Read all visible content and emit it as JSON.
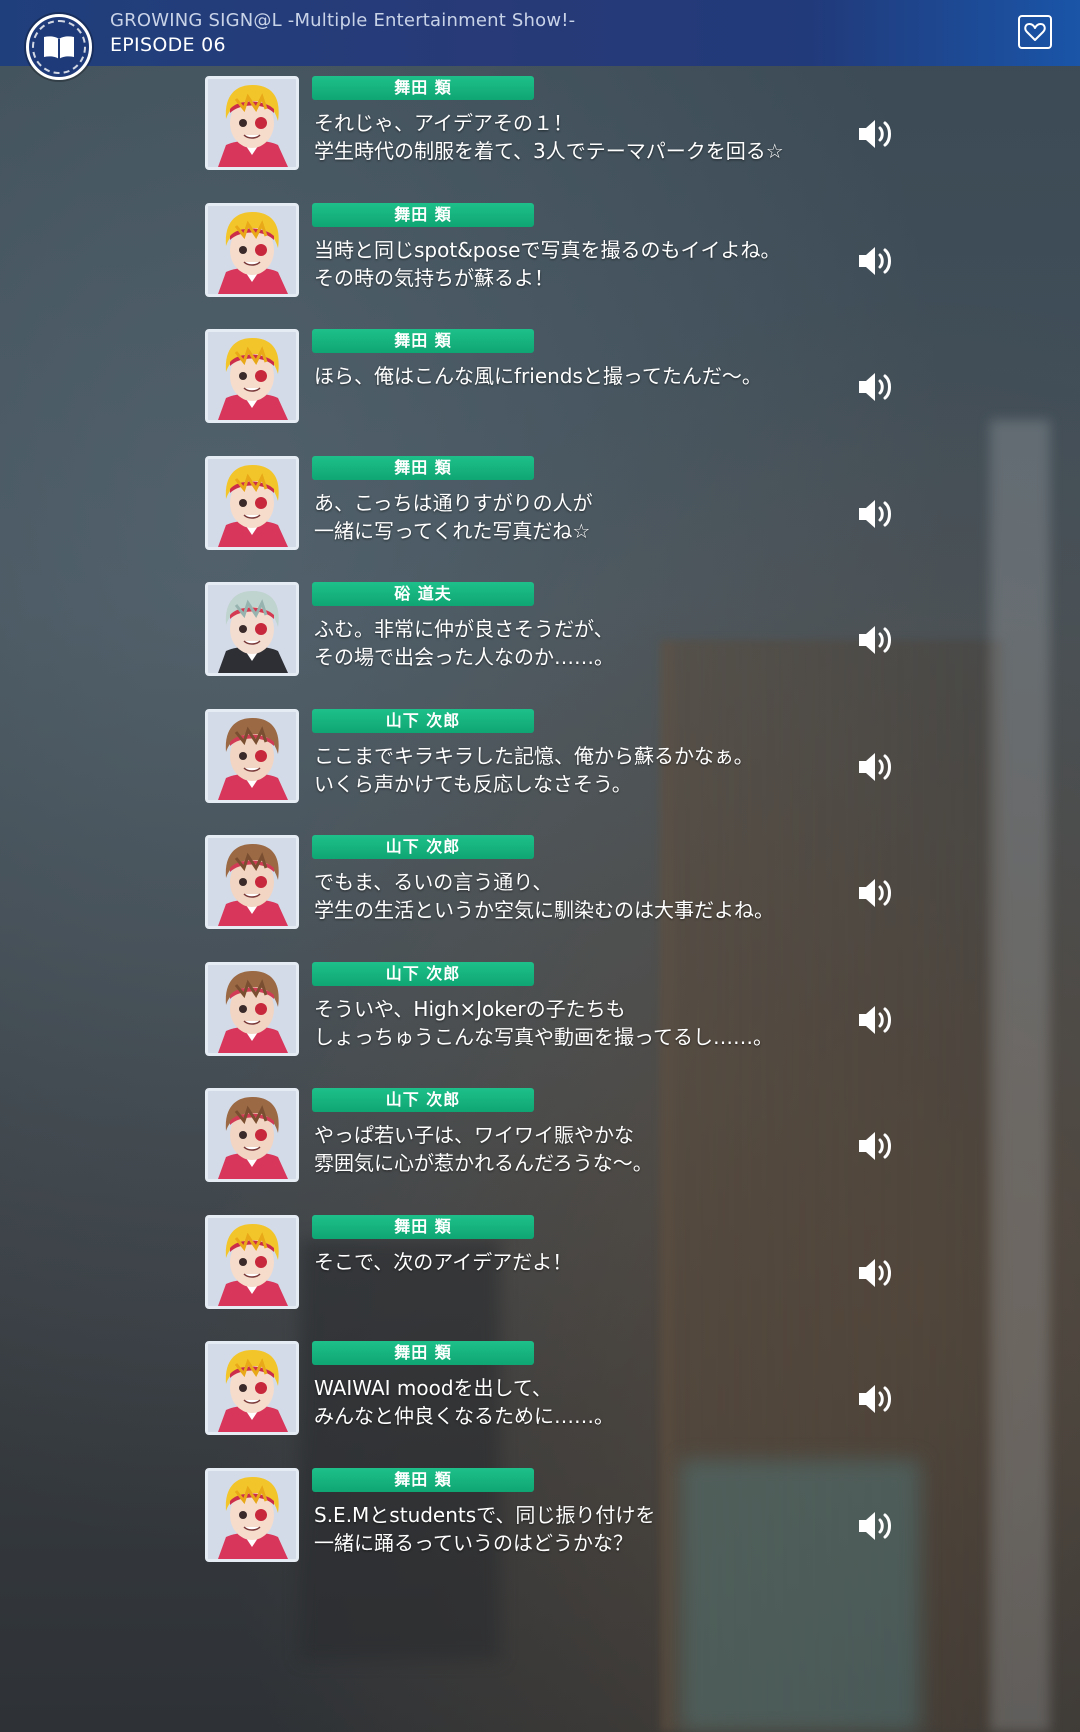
{
  "header": {
    "title": "GROWING SIGN@L -Multiple Entertainment Show!-",
    "episode": "EPISODE 06",
    "menu_icon": "open-book-icon",
    "favorite_icon": "heart-outline-icon"
  },
  "colors": {
    "header_bg": "#26397a",
    "name_tag": "#14b07e",
    "text": "#ffffff"
  },
  "log": [
    {
      "speaker": "舞田 類",
      "character": "rui",
      "line1": "それじゃ、アイデアその１！",
      "line2": "学生時代の制服を着て、3人でテーマパークを回る☆",
      "voice_icon": "speaker-icon"
    },
    {
      "speaker": "舞田 類",
      "character": "rui",
      "line1": "当時と同じspot&poseで写真を撮るのもイイよね。",
      "line2": "その時の気持ちが蘇るよ！",
      "voice_icon": "speaker-icon"
    },
    {
      "speaker": "舞田 類",
      "character": "rui",
      "line1": "ほら、俺はこんな風にfriendsと撮ってたんだ～。",
      "line2": "",
      "voice_icon": "speaker-icon"
    },
    {
      "speaker": "舞田 類",
      "character": "rui",
      "line1": "あ、こっちは通りすがりの人が",
      "line2": "一緒に写ってくれた写真だね☆",
      "voice_icon": "speaker-icon"
    },
    {
      "speaker": "硲 道夫",
      "character": "michio",
      "line1": "ふむ。非常に仲が良さそうだが、",
      "line2": "その場で出会った人なのか……。",
      "voice_icon": "speaker-icon"
    },
    {
      "speaker": "山下 次郎",
      "character": "jiro",
      "line1": "ここまでキラキラした記憶、俺から蘇るかなぁ。",
      "line2": "いくら声かけても反応しなさそう。",
      "voice_icon": "speaker-icon"
    },
    {
      "speaker": "山下 次郎",
      "character": "jiro",
      "line1": "でもま、るいの言う通り、",
      "line2": "学生の生活というか空気に馴染むのは大事だよね。",
      "voice_icon": "speaker-icon"
    },
    {
      "speaker": "山下 次郎",
      "character": "jiro",
      "line1": "そういや、High×Jokerの子たちも",
      "line2": "しょっちゅうこんな写真や動画を撮ってるし……。",
      "voice_icon": "speaker-icon"
    },
    {
      "speaker": "山下 次郎",
      "character": "jiro",
      "line1": "やっぱ若い子は、ワイワイ賑やかな",
      "line2": "雰囲気に心が惹かれるんだろうな～。",
      "voice_icon": "speaker-icon"
    },
    {
      "speaker": "舞田 類",
      "character": "rui",
      "line1": "そこで、次のアイデアだよ！",
      "line2": "",
      "voice_icon": "speaker-icon"
    },
    {
      "speaker": "舞田 類",
      "character": "rui",
      "line1": "WAIWAI moodを出して、",
      "line2": "みんなと仲良くなるために……。",
      "voice_icon": "speaker-icon"
    },
    {
      "speaker": "舞田 類",
      "character": "rui",
      "line1": "S.E.Mとstudentsで、同じ振り付けを",
      "line2": "一緒に踊るっていうのはどうかな？",
      "voice_icon": "speaker-icon"
    }
  ]
}
